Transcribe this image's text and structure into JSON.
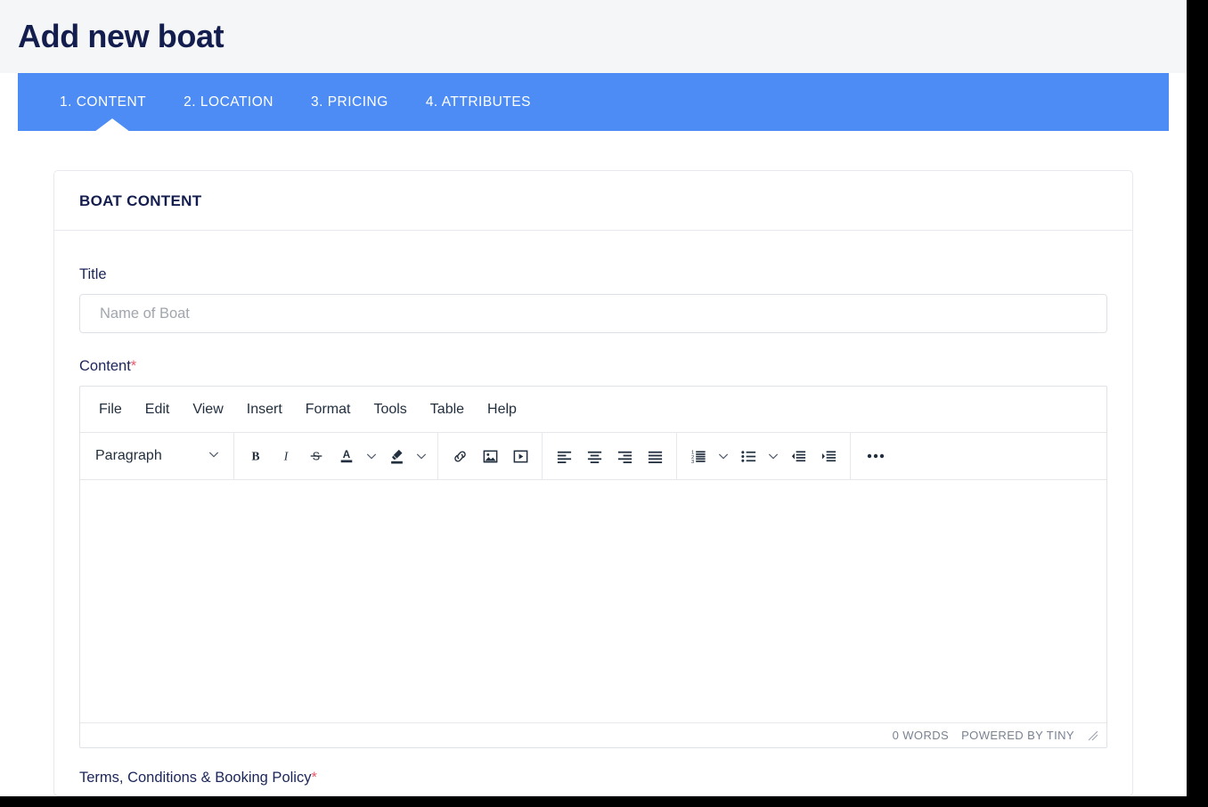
{
  "page": {
    "title": "Add new boat"
  },
  "tabs": [
    {
      "label": "1. CONTENT",
      "active": true
    },
    {
      "label": "2. LOCATION",
      "active": false
    },
    {
      "label": "3. PRICING",
      "active": false
    },
    {
      "label": "4. ATTRIBUTES",
      "active": false
    }
  ],
  "card": {
    "header": "BOAT CONTENT"
  },
  "form": {
    "title_label": "Title",
    "title_value": "",
    "title_placeholder": "Name of Boat",
    "content_label": "Content",
    "content_required_mark": "*",
    "terms_label": "Terms, Conditions & Booking Policy",
    "terms_required_mark": "*"
  },
  "editor": {
    "menubar": [
      "File",
      "Edit",
      "View",
      "Insert",
      "Format",
      "Tools",
      "Table",
      "Help"
    ],
    "block_format": "Paragraph",
    "body_text": "",
    "status": {
      "word_count": "0 WORDS",
      "branding": "POWERED BY TINY"
    },
    "toolbar": {
      "bold": "B",
      "italic": "I",
      "strikethrough": "S",
      "text_color": "A",
      "more": "•••"
    }
  },
  "colors": {
    "accent_blue": "#4e8cf5",
    "heading_navy": "#141e4e",
    "required_red": "#e8596b",
    "page_bg": "#f5f6f8",
    "border": "#dde1e6"
  }
}
